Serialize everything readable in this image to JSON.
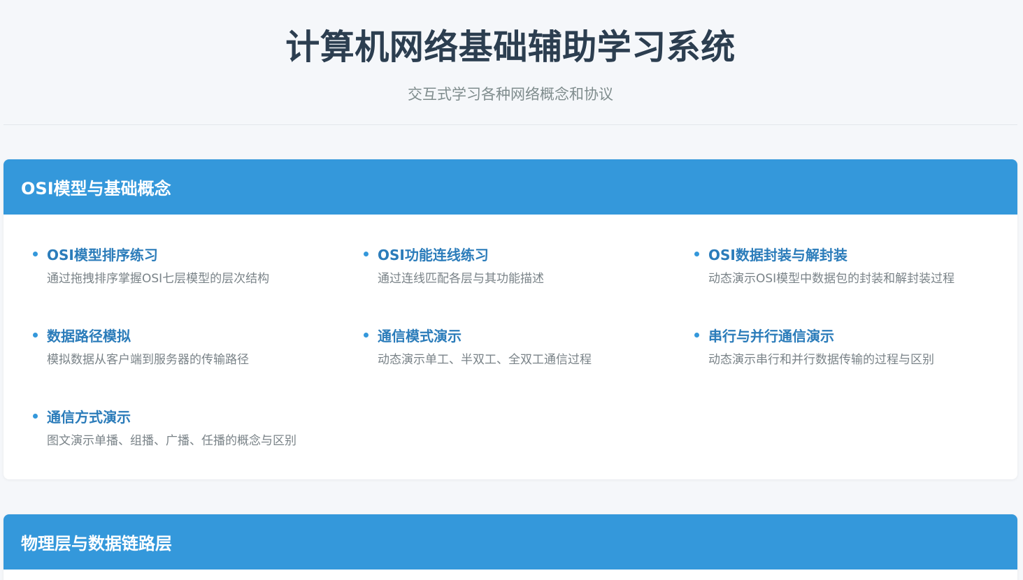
{
  "header": {
    "title": "计算机网络基础辅助学习系统",
    "subtitle": "交互式学习各种网络概念和协议"
  },
  "colors": {
    "accent": "#3498db",
    "link": "#2b7cba",
    "text_dark": "#2c3e50",
    "text_muted": "#7f8c8d",
    "background": "#f5f7fa"
  },
  "sections": [
    {
      "title": "OSI模型与基础概念",
      "topics": [
        {
          "title": "OSI模型排序练习",
          "desc": "通过拖拽排序掌握OSI七层模型的层次结构"
        },
        {
          "title": "OSI功能连线练习",
          "desc": "通过连线匹配各层与其功能描述"
        },
        {
          "title": "OSI数据封装与解封装",
          "desc": "动态演示OSI模型中数据包的封装和解封装过程"
        },
        {
          "title": "数据路径模拟",
          "desc": "模拟数据从客户端到服务器的传输路径"
        },
        {
          "title": "通信模式演示",
          "desc": "动态演示单工、半双工、全双工通信过程"
        },
        {
          "title": "串行与并行通信演示",
          "desc": "动态演示串行和并行数据传输的过程与区别"
        },
        {
          "title": "通信方式演示",
          "desc": "图文演示单播、组播、广播、任播的概念与区别"
        }
      ]
    },
    {
      "title": "物理层与数据链路层",
      "topics": []
    }
  ]
}
